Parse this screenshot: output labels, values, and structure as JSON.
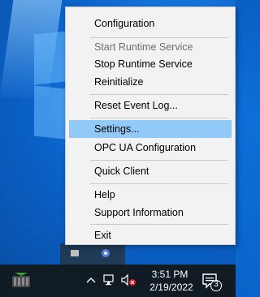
{
  "menu": {
    "items": [
      {
        "label": "Configuration",
        "state": "normal"
      },
      {
        "label": "Start Runtime Service",
        "state": "disabled"
      },
      {
        "label": "Stop Runtime Service",
        "state": "normal"
      },
      {
        "label": "Reinitialize",
        "state": "normal"
      },
      {
        "label": "Reset Event Log...",
        "state": "normal"
      },
      {
        "label": "Settings...",
        "state": "highlighted"
      },
      {
        "label": "OPC UA Configuration",
        "state": "normal"
      },
      {
        "label": "Quick Client",
        "state": "normal"
      },
      {
        "label": "Help",
        "state": "normal"
      },
      {
        "label": "Support Information",
        "state": "normal"
      },
      {
        "label": "Exit",
        "state": "normal"
      }
    ],
    "highlight_color": "#91c9f7"
  },
  "taskbar": {
    "time": "3:51 PM",
    "date": "2/19/2022",
    "notification_count": "3",
    "icons": [
      "kepserver-app-icon",
      "chevron-up-icon",
      "network-icon",
      "volume-muted-icon",
      "notification-icon"
    ]
  }
}
